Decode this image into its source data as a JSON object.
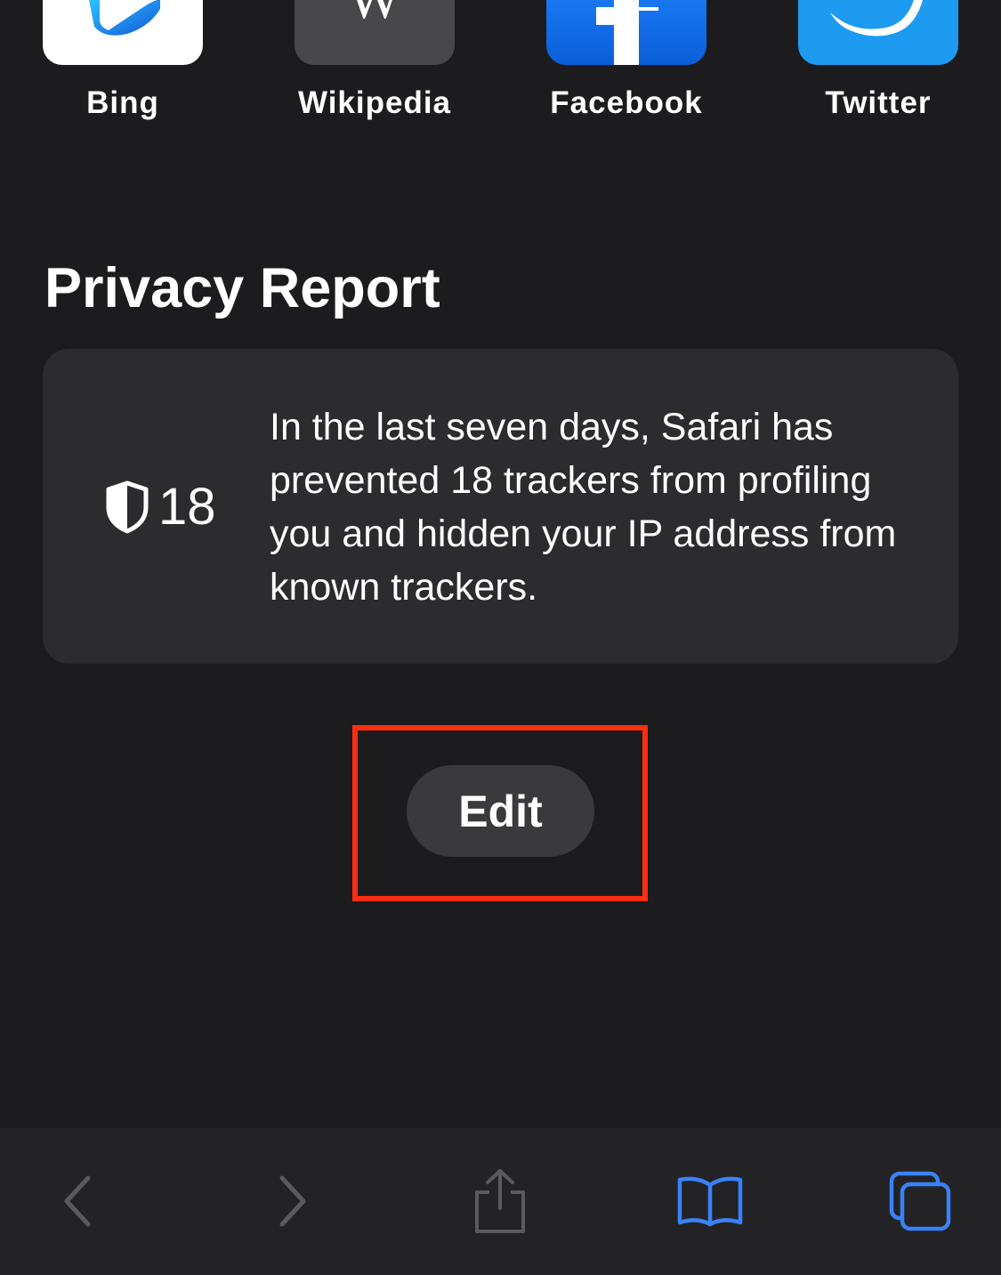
{
  "favorites": [
    {
      "label": "Bing",
      "icon": "bing-icon"
    },
    {
      "label": "Wikipedia",
      "icon": "wikipedia-icon"
    },
    {
      "label": "Facebook",
      "icon": "facebook-icon"
    },
    {
      "label": "Twitter",
      "icon": "twitter-icon"
    }
  ],
  "privacy_report": {
    "title": "Privacy Report",
    "tracker_count": "18",
    "description": "In the last seven days, Safari has prevented 18 trackers from profiling you and hidden your IP address from known trackers.",
    "icon": "shield-icon"
  },
  "edit_button": {
    "label": "Edit"
  },
  "highlight_color": "#ff2d12",
  "toolbar": {
    "items": [
      {
        "icon": "back-icon",
        "enabled": false
      },
      {
        "icon": "forward-icon",
        "enabled": false
      },
      {
        "icon": "share-icon",
        "enabled": false
      },
      {
        "icon": "bookmarks-icon",
        "enabled": true
      },
      {
        "icon": "tabs-icon",
        "enabled": true
      }
    ],
    "accent_color": "#3a82f7",
    "disabled_color": "#5a5a5e"
  }
}
